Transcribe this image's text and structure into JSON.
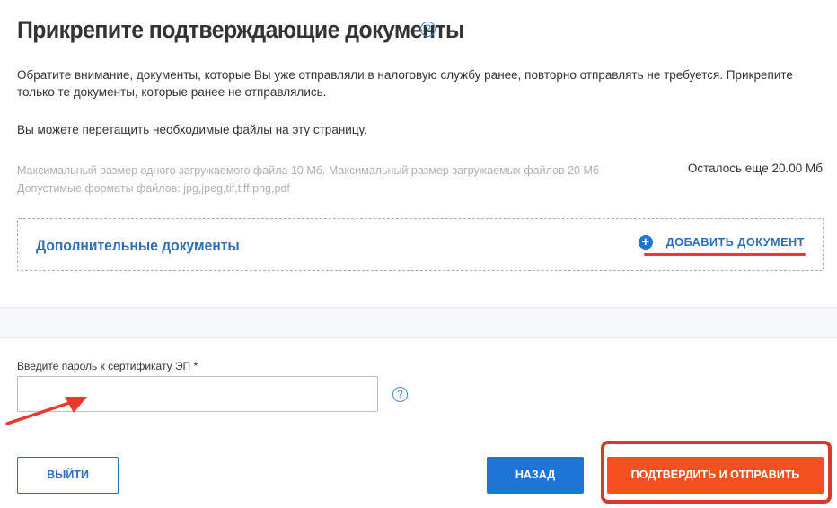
{
  "header": {
    "title": "Прикрепите подтверждающие документы",
    "help_icon": "?"
  },
  "info": {
    "notice": "Обратите внимание, документы, которые Вы уже отправляли в налоговую службу ранее, повторно отправлять не требуется. Прикрепите только те документы, которые ранее не отправлялись.",
    "drag_hint": "Вы можете перетащить необходимые файлы на эту страницу.",
    "max_size": "Максимальный размер одного загружаемого файла 10 Мб. Максимальный размер загружаемых файлов 20 Мб",
    "formats": "Допустимые форматы файлов: jpg,jpeg,tif,tiff,png,pdf",
    "remaining": "Осталось еще 20.00 Мб"
  },
  "documents": {
    "section_label": "Дополнительные документы",
    "add_icon": "+",
    "add_label": "ДОБАВИТЬ ДОКУМЕНТ"
  },
  "password": {
    "label": "Введите пароль к сертификату ЭП *",
    "value": "",
    "help_icon": "?"
  },
  "buttons": {
    "exit": "ВЫЙТИ",
    "back": "НАЗАД",
    "submit": "ПОДТВЕРДИТЬ И ОТПРАВИТЬ"
  },
  "colors": {
    "accent_blue": "#1e75d6",
    "submit_orange": "#f4511e",
    "annotation_red": "#e8392f"
  },
  "icons": {
    "help": "question-circle-icon",
    "add": "plus-circle-icon",
    "annotation": "red-arrow-icon"
  }
}
